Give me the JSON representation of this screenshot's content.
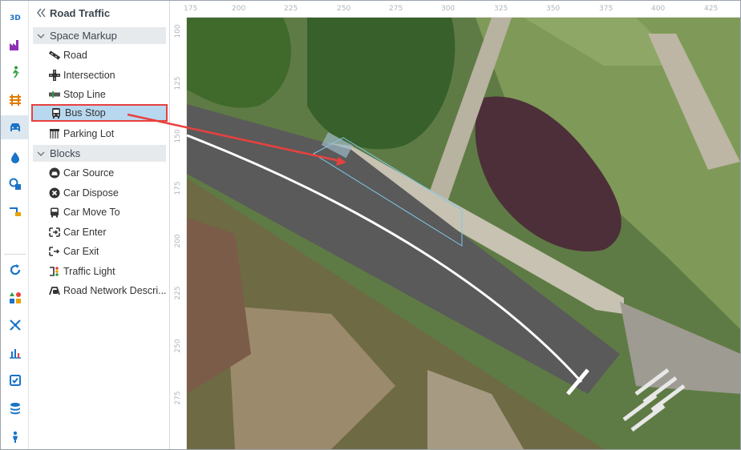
{
  "panel": {
    "title": "Road Traffic",
    "sections": [
      {
        "label": "Space Markup"
      },
      {
        "label": "Blocks"
      }
    ],
    "space_markup": [
      {
        "label": "Road",
        "icon": "road-icon"
      },
      {
        "label": "Intersection",
        "icon": "intersection-icon"
      },
      {
        "label": "Stop Line",
        "icon": "stop-line-icon"
      },
      {
        "label": "Bus Stop",
        "icon": "bus-stop-icon",
        "selected": true
      },
      {
        "label": "Parking Lot",
        "icon": "parking-lot-icon"
      }
    ],
    "blocks": [
      {
        "label": "Car Source",
        "icon": "car-source-icon"
      },
      {
        "label": "Car Dispose",
        "icon": "car-dispose-icon"
      },
      {
        "label": "Car Move To",
        "icon": "car-move-to-icon"
      },
      {
        "label": "Car Enter",
        "icon": "car-enter-icon"
      },
      {
        "label": "Car Exit",
        "icon": "car-exit-icon"
      },
      {
        "label": "Traffic Light",
        "icon": "traffic-light-icon"
      },
      {
        "label": "Road Network Descri...",
        "icon": "road-network-descriptor-icon"
      }
    ]
  },
  "rail": [
    "3d-icon",
    "factory-icon",
    "pedestrian-icon",
    "rail-icon",
    "road-traffic-icon",
    "fluid-icon",
    "material-handling-icon",
    "process-icon",
    "statecharts-icon",
    "agent-icon",
    "analysis-icon",
    "charts-icon",
    "presentation-icon",
    "connectivity-icon",
    "people-icon"
  ],
  "rulers": {
    "x_ticks": [
      "175",
      "200",
      "225",
      "250",
      "275",
      "300",
      "325",
      "350",
      "375",
      "400",
      "425"
    ],
    "y_ticks": [
      "100",
      "125",
      "150",
      "175",
      "200",
      "225",
      "250",
      "275"
    ]
  },
  "colors": {
    "accent": "#1a73c7",
    "selection": "#b8d8ef",
    "highlight_border": "#e8413f",
    "arrow": "#e8413f",
    "road": "#5a5a5a"
  }
}
